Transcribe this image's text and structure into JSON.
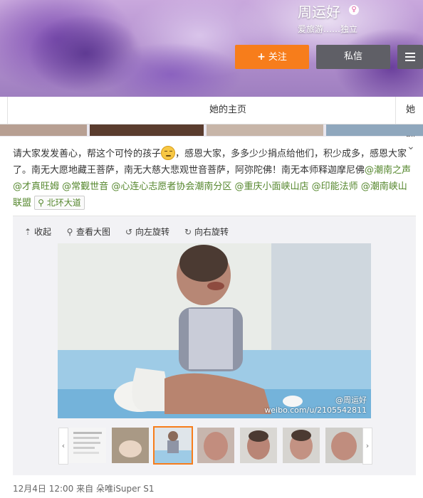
{
  "profile": {
    "nickname": "周运好",
    "signature": "爱旅游……独立",
    "follow_label": "关注",
    "message_label": "私信"
  },
  "tabs": {
    "home_label": "她的主页",
    "partial_label": "她的"
  },
  "post": {
    "text_before_emoji": "请大家发发善心，帮这个可怜的孩子",
    "text_after_emoji": "，感恩大家，多多少少捐点给他们，积少成多，感恩大家了。南无大愿地藏王菩萨，南无大慈大悲观世音菩萨，阿弥陀佛！南无本师释迦摩尼佛",
    "mentions": [
      "@潮南之声",
      "@才真旺姆",
      "@常觐世音",
      "@心连心志愿者协会潮南分区",
      "@重庆小面峡山店",
      "@印能法师",
      "@潮南峡山联盟"
    ],
    "location": "北环大道",
    "timestamp": "12月4日 12:00",
    "source_prefix": "来自",
    "source": "朵唯iSuper S1"
  },
  "media_toolbar": {
    "collapse": "收起",
    "view_large": "查看大图",
    "rotate_left": "向左旋转",
    "rotate_right": "向右旋转"
  },
  "photo": {
    "watermark_name": "@周运好",
    "watermark_url": "weibo.com/u/2105542811"
  },
  "colors": {
    "follow_button": "#f77d1b",
    "secondary_button": "#5f5f66",
    "link_green": "#55872d",
    "active_thumb_border": "#f77d1b"
  }
}
